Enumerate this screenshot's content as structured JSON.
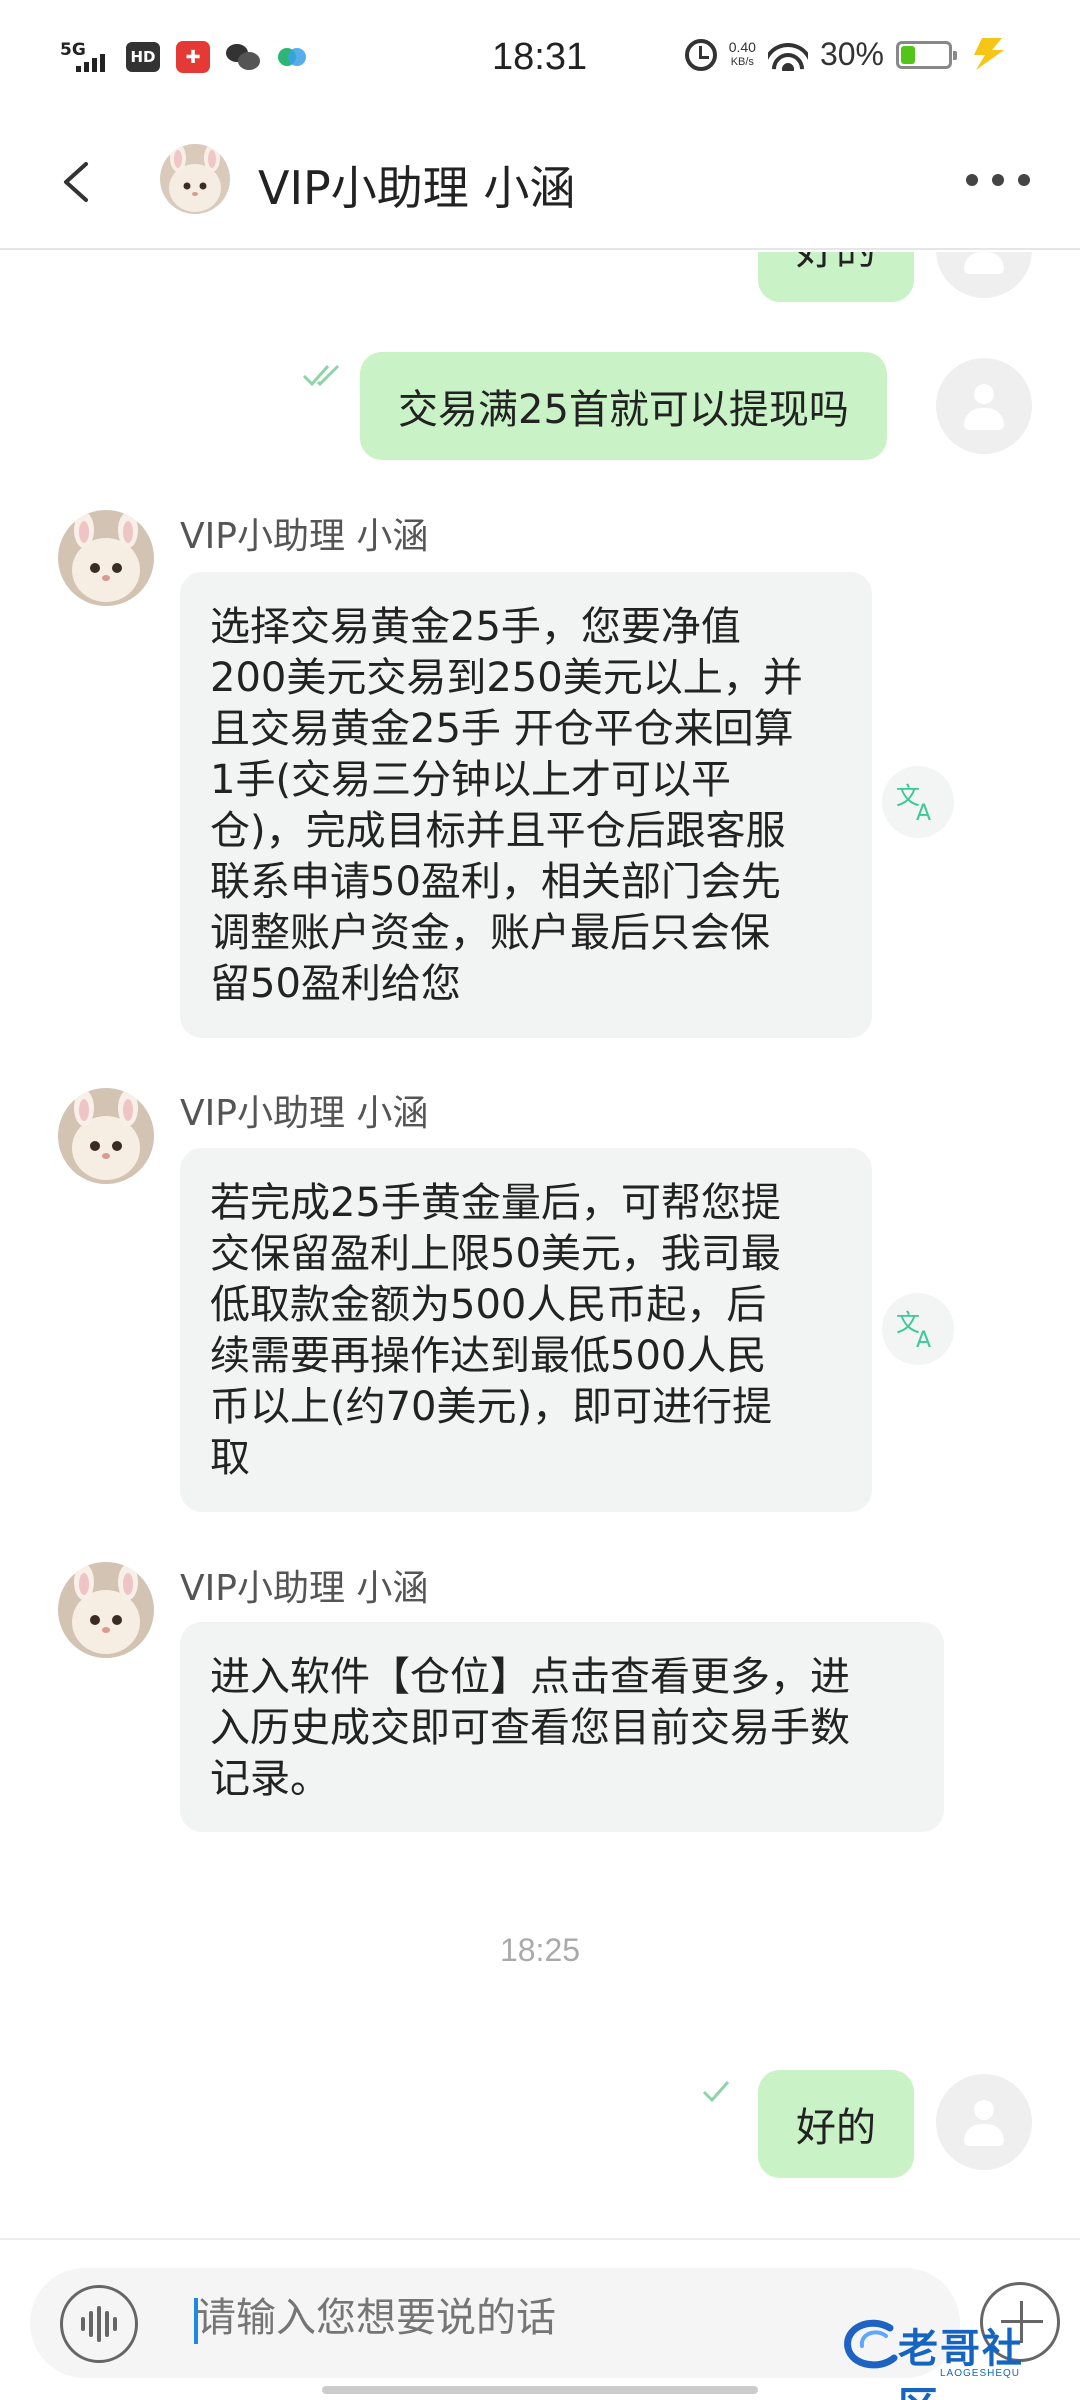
{
  "status_bar": {
    "network": "5G",
    "hd": "HD",
    "time": "18:31",
    "speed_value": "0.40",
    "speed_unit": "KB/s",
    "battery_pct": "30%",
    "battery_level": 0.3,
    "battery_color": "#52c41a"
  },
  "header": {
    "title": "VIP小助理 小涵",
    "back_icon": "chevron-left-icon",
    "more_icon": "more-horizontal-icon"
  },
  "messages": [
    {
      "from": "self",
      "text": "好的"
    },
    {
      "from": "self",
      "text": "交易满25首就可以提现吗"
    },
    {
      "from": "agent",
      "name": "VIP小助理 小涵",
      "lines": [
        "选择交易黄金25手，您要净值",
        "200美元交易到250美元以上，并",
        "且交易黄金25手 开仓平仓来回算",
        "1手(交易三分钟以上才可以平",
        "仓)，完成目标并且平仓后跟客服",
        "联系申请50盈利，相关部门会先",
        "调整账户资金，账户最后只会保",
        "留50盈利给您"
      ]
    },
    {
      "from": "agent",
      "name": "VIP小助理 小涵",
      "lines": [
        "若完成25手黄金量后，可帮您提",
        "交保留盈利上限50美元，我司最",
        "低取款金额为500人民币起，后",
        "续需要再操作达到最低500人民",
        "币以上(约70美元)，即可进行提",
        "取"
      ]
    },
    {
      "from": "agent",
      "name": "VIP小助理 小涵",
      "lines": [
        "进入软件【仓位】点击查看更多，进",
        "入历史成交即可查看您目前交易手数",
        "记录。"
      ]
    },
    {
      "from": "timestamp",
      "text": "18:25"
    },
    {
      "from": "self",
      "text": "好的"
    }
  ],
  "input": {
    "placeholder": "请输入您想要说的话",
    "voice_icon": "voice-wave-icon",
    "plus_icon": "plus-icon"
  },
  "watermark": {
    "text": "老哥社区",
    "subtext": "LAOGESHEQU"
  },
  "colors": {
    "outgoing_bubble": "#c9f2c6",
    "incoming_bubble": "#f2f3f3",
    "translate_icon": "#3cc89a",
    "read_check": "#8fd4a8"
  }
}
